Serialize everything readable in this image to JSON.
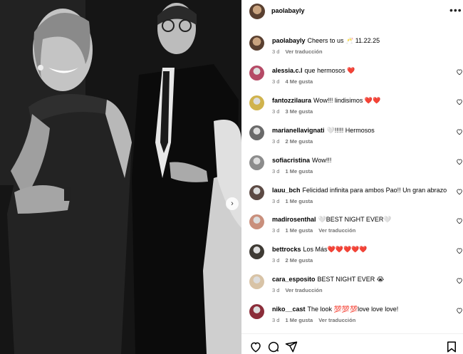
{
  "post": {
    "username": "paolabayly",
    "caption": {
      "username": "paolabayly",
      "text": "Cheers to us 🥂 11.22.25",
      "time": "3 d",
      "translate": "Ver traducción"
    }
  },
  "comments": [
    {
      "username": "alessia.c.l",
      "text": "que hermosos ❤️",
      "time": "3 d",
      "likes": "4 Me gusta",
      "translate": "",
      "avatar_color": "#b54a66"
    },
    {
      "username": "fantozzilaura",
      "text": "Wow!!! lindisimos ❤️❤️",
      "time": "3 d",
      "likes": "3 Me gusta",
      "translate": "",
      "avatar_color": "#d0b34d"
    },
    {
      "username": "marianellavignati",
      "text": "🤍!!!!! Hermosos",
      "time": "3 d",
      "likes": "2 Me gusta",
      "translate": "",
      "avatar_color": "#6a6a6a"
    },
    {
      "username": "sofiacristina",
      "text": "Wow!!!",
      "time": "3 d",
      "likes": "1 Me gusta",
      "translate": "",
      "avatar_color": "#8c8c8c"
    },
    {
      "username": "lauu_bch",
      "text": "Felicidad infinita para ambos Pao!! Un gran abrazo",
      "time": "3 d",
      "likes": "1 Me gusta",
      "translate": "",
      "avatar_color": "#5c4a44"
    },
    {
      "username": "madirosenthal",
      "text": "🤍BEST NIGHT EVER🤍",
      "time": "3 d",
      "likes": "1 Me gusta",
      "translate": "Ver traducción",
      "avatar_color": "#c98f7c"
    },
    {
      "username": "bettrocks",
      "text": "Los Más❤️❤️❤️❤️❤️",
      "time": "3 d",
      "likes": "2 Me gusta",
      "translate": "",
      "avatar_color": "#3e3a34"
    },
    {
      "username": "cara_esposito",
      "text": "BEST NIGHT EVER 😭",
      "time": "3 d",
      "likes": "",
      "translate": "Ver traducción",
      "avatar_color": "#d8c3a6"
    },
    {
      "username": "niko__cast",
      "text": "The look 💯💯💯love love love!",
      "time": "3 d",
      "likes": "1 Me gusta",
      "translate": "Ver traducción",
      "avatar_color": "#8b2d3a"
    }
  ],
  "colors": {
    "heart_red": "#e0245e",
    "meta_gray": "#737373",
    "border": "#efefef"
  },
  "icons": [
    "more-icon",
    "heart-icon",
    "comment-icon",
    "share-icon",
    "bookmark-icon",
    "chevron-right-icon"
  ]
}
